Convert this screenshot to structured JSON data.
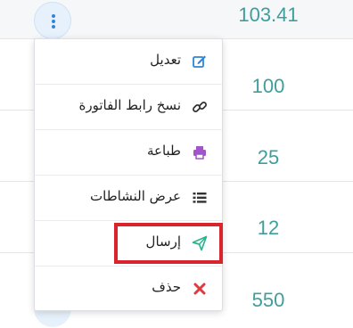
{
  "table": {
    "amounts": [
      "103.41",
      "100",
      "25",
      "12",
      "550"
    ]
  },
  "actions_menu": {
    "items": [
      {
        "label": "تعديل",
        "icon": "edit-icon",
        "color": "#2f86d6"
      },
      {
        "label": "نسخ رابط الفاتورة",
        "icon": "link-icon",
        "color": "#333333"
      },
      {
        "label": "طباعة",
        "icon": "printer-icon",
        "color": "#a155c9"
      },
      {
        "label": "عرض النشاطات",
        "icon": "list-icon",
        "color": "#333333"
      },
      {
        "label": "إرسال",
        "icon": "send-icon",
        "color": "#2bb38f"
      },
      {
        "label": "حذف",
        "icon": "delete-icon",
        "color": "#e0393e"
      }
    ]
  },
  "colors": {
    "highlight": "#d9232d",
    "amount_text": "#3f9e9c",
    "accent": "#2f86d6"
  }
}
